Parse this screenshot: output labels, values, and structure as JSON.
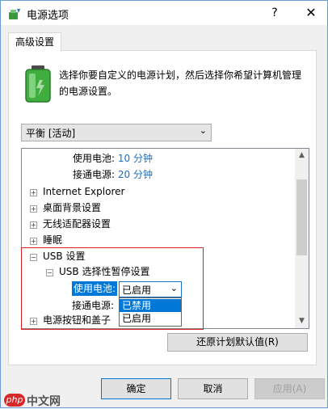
{
  "window": {
    "title": "电源选项",
    "help": "?",
    "close": "✕"
  },
  "tab": {
    "label": "高级设置"
  },
  "description": "选择你要自定义的电源计划，然后选择你希望计算机管理的电源设置。",
  "plan": {
    "selected": "平衡 [活动]",
    "arrow": "⌄"
  },
  "tree": {
    "battery_label": "使用电池:",
    "battery_value": "10 分钟",
    "plugged_label": "接通电源:",
    "plugged_value": "20 分钟",
    "items": [
      "Internet Explorer",
      "桌面背景设置",
      "无线适配器设置",
      "睡眠"
    ],
    "usb": "USB 设置",
    "usb_suspend": "USB 选择性暂停设置",
    "usb_battery_label": "使用电池:",
    "usb_plugged_label": "接通电源:",
    "usb_battery_value": "已启用",
    "dropdown_options": [
      "已禁用",
      "已启用"
    ],
    "power_buttons": "电源按钮和盖子"
  },
  "buttons": {
    "restore": "还原计划默认值(R)",
    "ok": "确定",
    "cancel": "取消",
    "apply": "应用(A)"
  },
  "watermark": {
    "badge": "php",
    "text": "中文网"
  },
  "colors": {
    "accent": "#0078d7",
    "value_blue": "#1a6fc4",
    "highlight_border": "#e02020"
  }
}
